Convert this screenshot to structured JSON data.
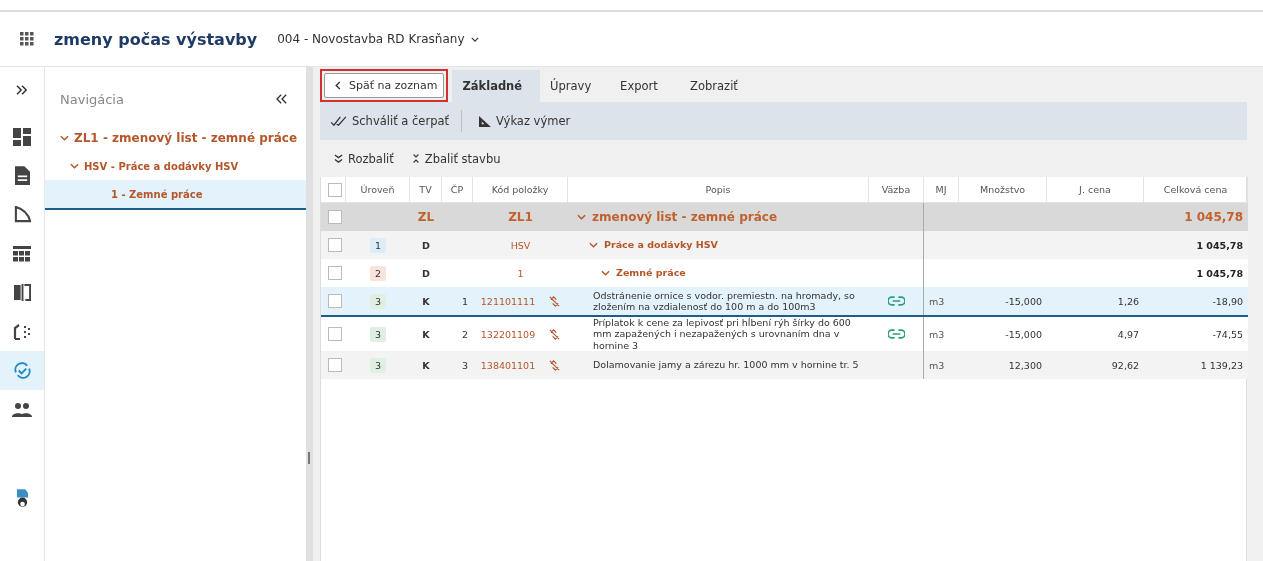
{
  "header": {
    "app_title": "zmeny počas výstavby",
    "project": "004 - Novostavba RD Krasňany"
  },
  "rail": [
    {
      "kind": "dashboard",
      "selected": false
    },
    {
      "kind": "document",
      "selected": false
    },
    {
      "kind": "triangle",
      "selected": false
    },
    {
      "kind": "table",
      "selected": false
    },
    {
      "kind": "compare",
      "selected": false
    },
    {
      "kind": "plan",
      "selected": false
    },
    {
      "kind": "sync",
      "selected": true
    },
    {
      "kind": "people",
      "selected": false
    }
  ],
  "navigation": {
    "title": "Navigácia",
    "tree": [
      {
        "label": "ZL1 - zmenový list - zemné práce",
        "expanded": true,
        "selected": false,
        "children": [
          {
            "label": "HSV - Práce a dodávky HSV",
            "expanded": true,
            "selected": false,
            "children": [
              {
                "label": "1 - Zemné práce",
                "selected": true
              }
            ]
          }
        ]
      }
    ]
  },
  "back_button": "Späť na zoznam",
  "tabs": [
    {
      "label": "Základné",
      "selected": true
    },
    {
      "label": "Úpravy",
      "selected": false
    },
    {
      "label": "Export",
      "selected": false
    },
    {
      "label": "Zobraziť",
      "selected": false
    }
  ],
  "toolbar": [
    {
      "label": "Schváliť a čerpať",
      "kind": "approve"
    },
    {
      "label": "Výkaz výmer",
      "kind": "measure"
    }
  ],
  "actions": [
    {
      "label": "Rozbaliť",
      "kind": "expand"
    },
    {
      "label": "Zbaliť stavbu",
      "kind": "collapse"
    }
  ],
  "table": {
    "all_checked": false,
    "columns": [
      "Úroveň",
      "TV",
      "ČP",
      "Kód položky",
      "Popis",
      "Väzba",
      "MJ",
      "Množstvo",
      "J. cena",
      "Celková cena"
    ],
    "rows": [
      {
        "kind": "group",
        "checked": false,
        "level": "",
        "tv": "ZL",
        "cp": "",
        "code": "ZL1",
        "description": "zmenový list - zemné práce",
        "expanded": true,
        "linked": false,
        "mj": "",
        "quantity": "",
        "unit_price": "",
        "total": "1 045,78",
        "selected": false
      },
      {
        "kind": "section",
        "checked": false,
        "level": "1",
        "color": "#dcecf8",
        "tv": "D",
        "cp": "",
        "code": "HSV",
        "description": "Práce a dodávky HSV",
        "expanded": true,
        "linked": false,
        "mj": "",
        "quantity": "",
        "unit_price": "",
        "total": "1 045,78",
        "selected": false
      },
      {
        "kind": "section",
        "checked": false,
        "level": "2",
        "color": "#fae3da",
        "tv": "D",
        "cp": "",
        "code": "1",
        "description": "Zemné práce",
        "expanded": true,
        "linked": false,
        "mj": "",
        "quantity": "",
        "unit_price": "",
        "total": "1 045,78",
        "selected": false
      },
      {
        "kind": "item",
        "checked": false,
        "level": "3",
        "color": "#dff0e2",
        "tv": "K",
        "cp": "1",
        "code": "121101111",
        "description": "Odstránenie ornice s vodor. premiestn. na hromady, so zložením na vzdialenosť do 100 m a do 100m3",
        "linked": true,
        "mj": "m3",
        "quantity": "-15,000",
        "unit_price": "1,26",
        "total": "-18,90",
        "selected": true
      },
      {
        "kind": "item",
        "checked": false,
        "level": "3",
        "color": "#dff0e2",
        "tv": "K",
        "cp": "2",
        "code": "132201109",
        "description": "Príplatok k cene za lepivosť pri hĺbení rýh šírky do 600 mm zapažených i nezapažených s urovnaním dna v hornine 3",
        "linked": true,
        "mj": "m3",
        "quantity": "-15,000",
        "unit_price": "4,97",
        "total": "-74,55",
        "selected": false
      },
      {
        "kind": "item",
        "checked": false,
        "level": "3",
        "color": "#dff0e2",
        "tv": "K",
        "cp": "3",
        "code": "138401101",
        "description": "Dolamovanie jamy a zárezu hr. 1000 mm v hornine tr. 5",
        "linked": false,
        "mj": "m3",
        "quantity": "12,300",
        "unit_price": "92,62",
        "total": "1 139,23",
        "selected": false
      }
    ]
  }
}
